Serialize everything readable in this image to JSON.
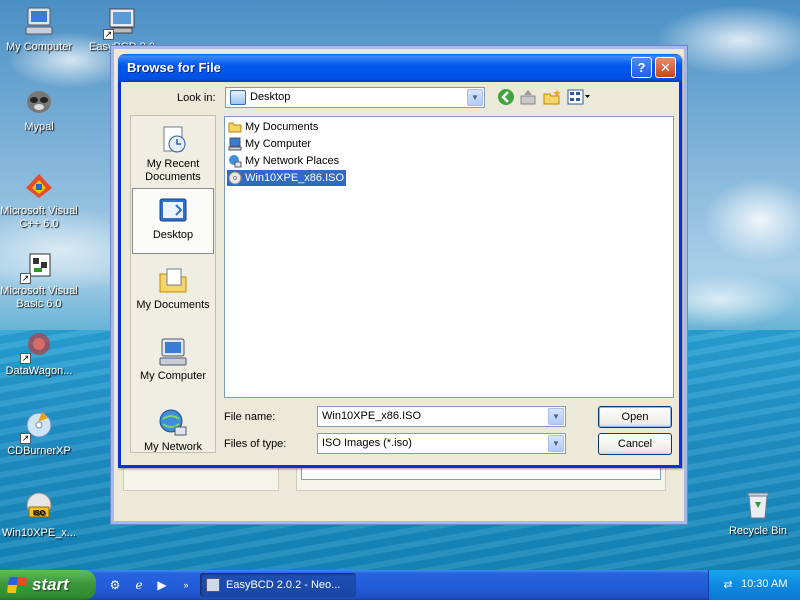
{
  "desktop": {
    "icons": [
      {
        "label": "My Computer",
        "icon": "my-computer-icon"
      },
      {
        "label": "EasyBCD 2.0",
        "icon": "easybcd-icon"
      },
      {
        "label": "Mypal",
        "icon": "mypal-icon"
      },
      {
        "label": "Microsoft Visual\nC++ 6.0",
        "icon": "visual-cpp-icon"
      },
      {
        "label": "Microsoft Visual\nBasic 6.0",
        "icon": "visual-basic-icon"
      },
      {
        "label": "DataWagon...",
        "icon": "datawagon-icon"
      },
      {
        "label": "CDBurnerXP",
        "icon": "cdburnerxp-icon"
      },
      {
        "label": "Win10XPE_x...",
        "icon": "iso-file-icon"
      },
      {
        "label": "Recycle Bin",
        "icon": "recycle-bin-icon"
      }
    ]
  },
  "dialog": {
    "title": "Browse for File",
    "help_glyph": "?",
    "close_glyph": "✕",
    "look_in_label": "Look in:",
    "look_in_value": "Desktop",
    "places": [
      {
        "label": "My Recent\nDocuments"
      },
      {
        "label": "Desktop"
      },
      {
        "label": "My Documents"
      },
      {
        "label": "My Computer"
      },
      {
        "label": "My Network"
      }
    ],
    "files": [
      {
        "name": "My Documents"
      },
      {
        "name": "My Computer"
      },
      {
        "name": "My Network Places"
      },
      {
        "name": "Win10XPE_x86.ISO"
      }
    ],
    "file_name_label": "File name:",
    "file_name_value": "Win10XPE_x86.ISO",
    "file_type_label": "Files of type:",
    "file_type_value": "ISO Images (*.iso)",
    "open_label": "Open",
    "cancel_label": "Cancel"
  },
  "taskbar": {
    "start_label": "start",
    "task_label": "EasyBCD 2.0.2 - Neo...",
    "clock": "10:30 AM"
  }
}
